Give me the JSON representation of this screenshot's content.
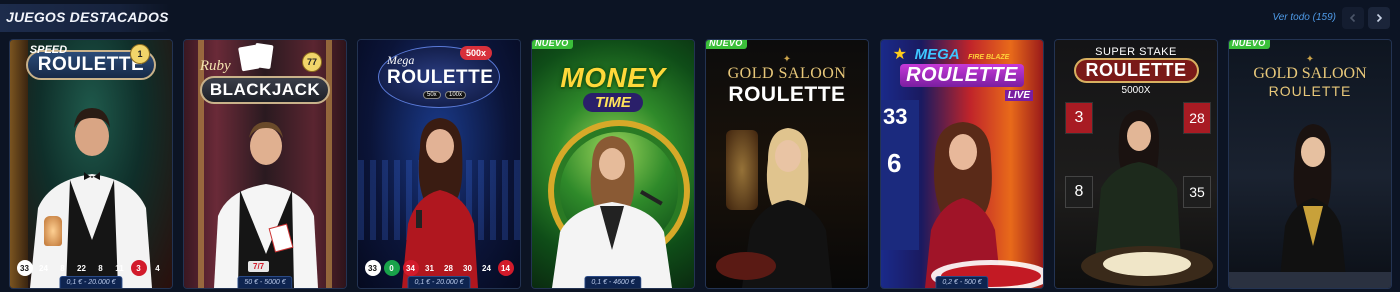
{
  "header": {
    "title": "JUEGOS DESTACADOS",
    "see_all": "Ver todo (159)"
  },
  "colors": {
    "background": "#0c1424",
    "accent_link": "#4f9be8",
    "new_badge": "#3bbf3a",
    "limit_badge": "#0e2450"
  },
  "games": [
    {
      "logo_small": "SPEED",
      "logo_big": "ROULETTE",
      "corner_badge": "1",
      "results": [
        "33",
        "24",
        "8",
        "22",
        "8",
        "11",
        "3",
        "4"
      ],
      "limit": "0,1 € - 20.000 €"
    },
    {
      "logo_small": "Ruby",
      "logo_big": "BLACKJACK",
      "corner_badge": "77",
      "score": "7/7",
      "limit": "50 € - 5000 €"
    },
    {
      "logo_small": "Mega",
      "logo_big": "ROULETTE",
      "multiplier": "500x",
      "mini_badges": [
        "50x",
        "100x"
      ],
      "results": [
        "33",
        "0",
        "34",
        "31",
        "28",
        "30",
        "24",
        "14"
      ],
      "limit": "0,1 € - 20.000 €"
    },
    {
      "badge": "NUEVO",
      "logo_big": "MONEY",
      "logo_sub": "TIME",
      "limit": "0,1 € - 4600 €"
    },
    {
      "badge": "NUEVO",
      "logo_small": "GOLD SALOON",
      "logo_big": "ROULETTE"
    },
    {
      "logo_small": "MEGA",
      "logo_tag": "FIRE BLAZE",
      "logo_big": "ROULETTE",
      "logo_sub": "LIVE",
      "side_numbers": [
        "33",
        "6"
      ],
      "limit": "0,2 € - 500 €"
    },
    {
      "logo_small": "SUPER STAKE",
      "logo_big": "ROULETTE",
      "logo_sub": "5000X",
      "board_numbers": [
        "3",
        "28",
        "8",
        "35"
      ]
    },
    {
      "badge": "NUEVO",
      "logo_small": "GOLD SALOON",
      "logo_big": "ROULETTE"
    }
  ]
}
